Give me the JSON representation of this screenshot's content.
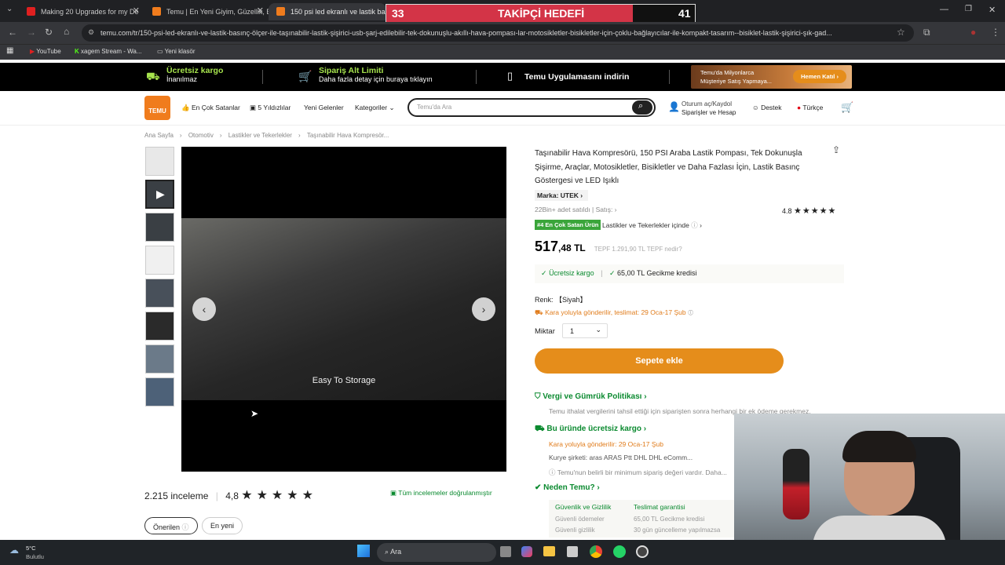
{
  "browser": {
    "tabs": [
      {
        "title": "Making 20 Upgrades for my De",
        "color": "#e02020"
      },
      {
        "title": "Temu | En Yeni Giyim, Güzellik, E",
        "color": "#f07c1d"
      },
      {
        "title": "150 psi led ekranlı ve lastik bas",
        "color": "#f07c1d"
      }
    ],
    "url": "temu.com/tr/150-psi-led-ekranlı-ve-lastik-basınç-ölçer-ile-taşınabilir-lastik-şişirici-usb-şarj-edilebilir-tek-dokunuşlu-akıllı-hava-pompası-lar-motosikletler-bisikletler-için-çoklu-bağlayıcılar-ile-kompakt-tasarım--bisiklet-lastik-şişirici-şık-gad...",
    "bookmarks": [
      "YouTube",
      "xagem Stream - Wa...",
      "Yeni klasör"
    ]
  },
  "goal": {
    "current": "33",
    "label": "TAKİPÇİ HEDEFİ",
    "target": "41",
    "progress": 0.8
  },
  "promo": {
    "free_shipping_title": "Ücretsiz kargo",
    "free_shipping_sub": "İnanılmaz",
    "order_limit_title": "Sipariş Alt Limiti",
    "order_limit_sub": "Daha fazla detay için buraya tıklayın",
    "app_download": "Temu Uygulamasını indirin",
    "join_text_1": "Temu'da Milyonlarca",
    "join_text_2": "Müşteriye Satış Yapmaya...",
    "join_button": "Hemen Katıl"
  },
  "header": {
    "logo": "TEMU",
    "best_sellers": "En Çok Satanlar",
    "five_stars": "5 Yıldızlılar",
    "new_arrivals": "Yeni Gelenler",
    "categories": "Kategoriler",
    "search_placeholder": "Temu'da Ara",
    "account_line1": "Oturum aç/Kaydol",
    "account_line2": "Siparişler ve Hesap",
    "support": "Destek",
    "language": "Türkçe"
  },
  "breadcrumb": [
    "Ana Sayfa",
    "Otomotiv",
    "Lastikler ve Tekerlekler",
    "Taşınabilir Hava Kompresör..."
  ],
  "media": {
    "caption": "Easy To Storage"
  },
  "product": {
    "title": "Taşınabilir Hava Kompresörü, 150 PSI Araba Lastik Pompası, Tek Dokunuşla Şişirme, Araçlar, Motosikletler, Bisikletler ve Daha Fazlası İçin, Lastik Basınç Göstergesi ve LED Işıklı",
    "brand": "Marka: UTEK",
    "sold": "22Bin+ adet satıldı | Satış:",
    "rating": "4.8",
    "rank_badge": "#4 En Çok Satan Ürün",
    "rank_category": "Lastikler ve Tekerlekler içinde",
    "price_int": "517",
    "price_dec": ",48 TL",
    "price_old": "TEPF 1.291,90 TL TEPF nedir?",
    "free_shipping": "Ücretsiz kargo",
    "delay_credit": "65,00 TL Gecikme kredisi",
    "color_label": "Renk: 【Siyah】",
    "delivery": "Kara yoluyla gönderilir, teslimat: 29 Oca-17 Şub",
    "qty_label": "Miktar",
    "qty_value": "1",
    "add_to_cart": "Sepete ekle",
    "tax_policy_title": "Vergi ve Gümrük Politikası",
    "tax_policy_text": "Temu ithalat vergilerini tahsil ettiği için siparişten sonra herhangi bir ek ödeme gerekmez.",
    "free_ship_title": "Bu üründe ücretsiz kargo",
    "free_ship_text": "Kara yoluyla gönderilir: 29 Oca-17 Şub",
    "couriers": "Kurye şirketi: aras ARAS Ptt DHL DHL eComm...",
    "min_order": "Temu'nun belirli bir minimum sipariş değeri vardır. Daha...",
    "why_temu": "Neden Temu?",
    "security_title": "Güvenlik ve Gizlilik",
    "security_1": "Güvenli ödemeler",
    "security_2": "Güvenli gizlilik",
    "delivery_guarantee": "Teslimat garantisi",
    "guarantee_1": "65,00 TL Gecikme kredisi",
    "guarantee_2": "30 gün güncelleme yapılmazsa"
  },
  "reviews": {
    "count": "2.215 inceleme",
    "rating": "4,8",
    "verified": "Tüm incelemeler doğrulanmıştır",
    "sort_recommended": "Önerilen",
    "sort_newest": "En yeni"
  },
  "taskbar": {
    "weather_temp": "5°C",
    "weather_desc": "Bulutlu",
    "search": "Ara"
  }
}
